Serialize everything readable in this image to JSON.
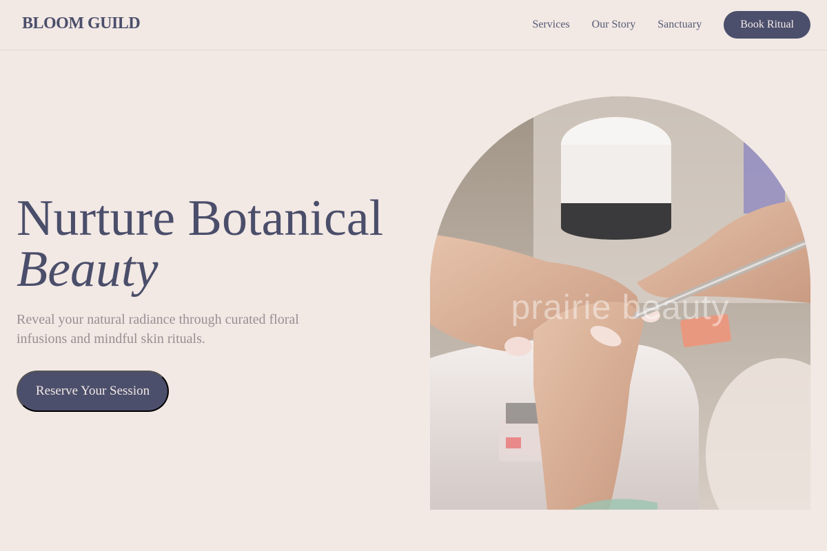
{
  "brand": {
    "logo": "BLOOM GUILD"
  },
  "nav": {
    "links": [
      "Services",
      "Our Story",
      "Sanctuary"
    ],
    "cta": "Book Ritual"
  },
  "hero": {
    "title_line1": "Nurture Botanical",
    "title_line2": "Beauty",
    "subtitle": "Reveal your natural radiance through curated floral infusions and mindful skin rituals.",
    "cta": "Reserve Your Session"
  },
  "image": {
    "subject": "manicure-photo",
    "watermark": "prairie beauty"
  },
  "colors": {
    "background": "#f2e8e4",
    "primary": "#4b4f6c",
    "muted_text": "#9a8e93"
  }
}
